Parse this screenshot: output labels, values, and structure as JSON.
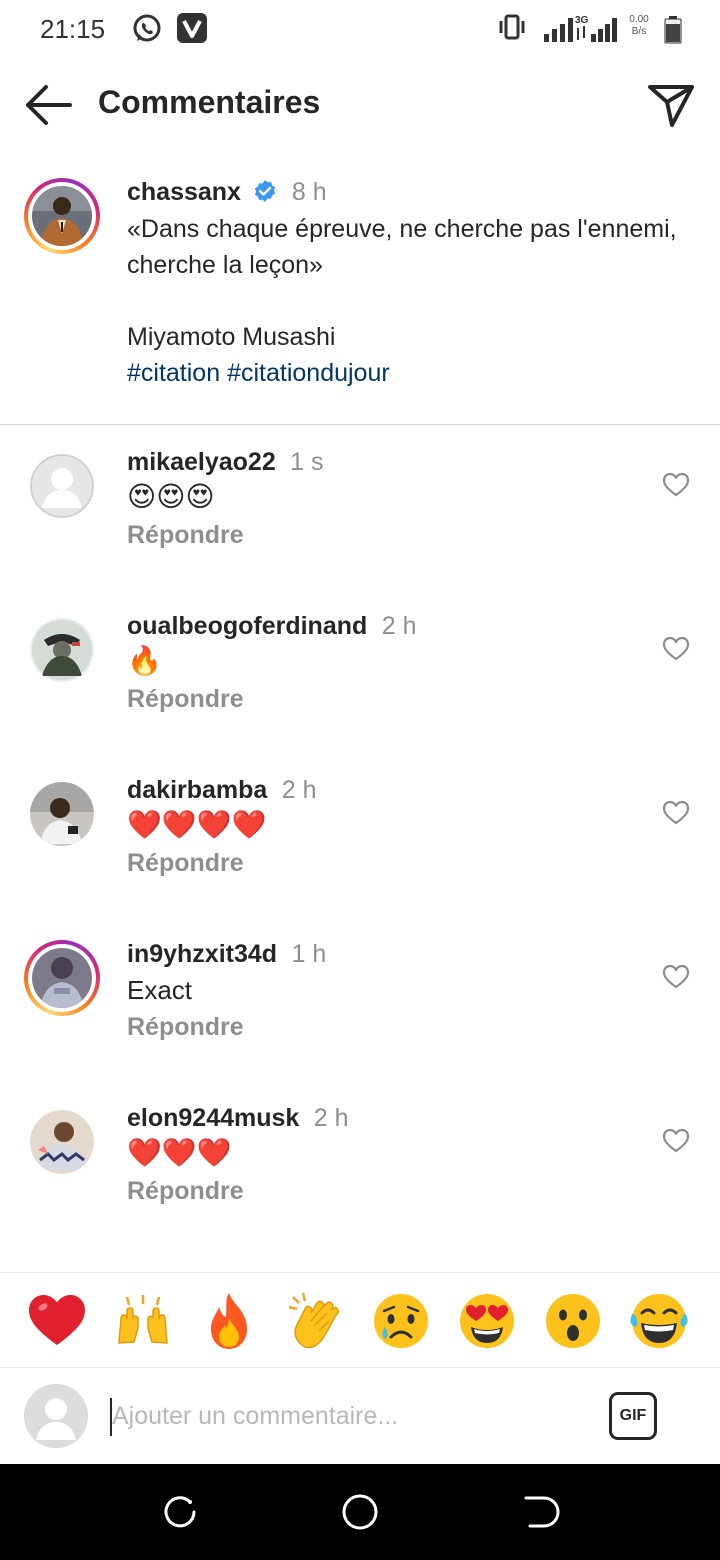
{
  "status_bar": {
    "time": "21:15",
    "icons": [
      "whatsapp-icon",
      "vlc-icon",
      "vibrate-icon",
      "signal-3g-icon",
      "signal-icon",
      "battery-icon"
    ],
    "network_label": "3G",
    "speed_value": "0.00",
    "speed_unit": "B/s"
  },
  "header": {
    "title": "Commentaires",
    "back_icon": "arrow-left-icon",
    "send_icon": "send-icon"
  },
  "caption": {
    "username": "chassanx",
    "verified": true,
    "time": "8 h",
    "text": "«Dans chaque épreuve, ne cherche pas l'ennemi, cherche la leçon»\n\nMiyamoto Musashi",
    "hashtags": [
      "#citation",
      "#citationdujour"
    ]
  },
  "comments": [
    {
      "username": "mikaelyao22",
      "time": "1 s",
      "text": "😍😍😍",
      "reply_label": "Répondre"
    },
    {
      "username": "oualbeogoferdinand",
      "time": "2 h",
      "text": "🔥",
      "reply_label": "Répondre"
    },
    {
      "username": "dakirbamba",
      "time": "2 h",
      "text": "❤️❤️❤️❤️",
      "reply_label": "Répondre"
    },
    {
      "username": "in9yhzxit34d",
      "time": "1 h",
      "text": "Exact",
      "reply_label": "Répondre"
    },
    {
      "username": "elon9244musk",
      "time": "2 h",
      "text": "❤️❤️❤️",
      "reply_label": "Répondre"
    }
  ],
  "quick_emojis": [
    "❤️",
    "🙌",
    "🔥",
    "👏",
    "😢",
    "😍",
    "😮",
    "😂"
  ],
  "input": {
    "placeholder": "Ajouter un commentaire...",
    "gif_label": "GIF"
  },
  "colors": {
    "text": "#262626",
    "secondary": "#8e8e8e",
    "hashtag": "#00376b",
    "verified": "#3897f0",
    "divider": "#dbdbdb"
  }
}
